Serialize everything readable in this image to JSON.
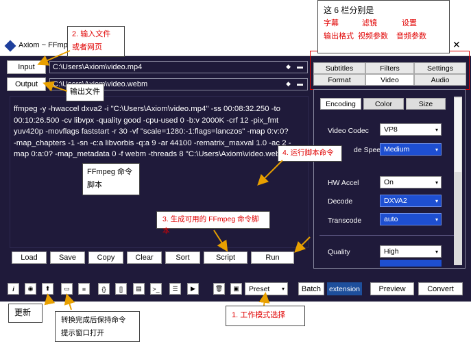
{
  "window": {
    "title": "Axiom ~ FFmpeg"
  },
  "main": {
    "input_label": "Input",
    "input_value": "C:\\Users\\Axiom\\video.mp4",
    "output_label": "Output",
    "output_value": "C:\\Users\\Axiom\\video.webm",
    "script_lines": [
      "ffmpeg -y -hwaccel dxva2 -i \"C:\\Users\\Axiom\\video.mp4\" -ss 00:08:32.250 -to",
      "00:10:26.500 -cv libvpx -quality good -cpu-used 0 -b:v 2000K -crf 12 -pix_fmt",
      "yuv420p -movflags faststart -r 30 -vf \"scale=1280:-1:flags=lanczos\" -map 0:v:0?",
      "-map_chapters -1 -sn -c:a libvorbis -q:a 9 -ar 44100 -rematrix_maxval 1.0 -ac 2 -",
      "map 0:a:0? -map_metadata 0 -f webm -threads 8 \"C:\\Users\\Axiom\\video.webm\""
    ],
    "buttons": [
      "Load",
      "Save",
      "Copy",
      "Clear",
      "Sort",
      "Script",
      "Run"
    ]
  },
  "right": {
    "tabs_row1": [
      "Subtitles",
      "Filters",
      "Settings"
    ],
    "tabs_row2": [
      "Format",
      "Video",
      "Audio"
    ],
    "subtabs": [
      "Encoding",
      "Color",
      "Size"
    ],
    "video_codec_label": "Video Codec",
    "video_codec": "VP8",
    "encode_speed_label": "de Speed",
    "encode_speed": "Medium",
    "hw_accel_label": "HW Accel",
    "hw_accel": "On",
    "decode_label": "Decode",
    "decode": "DXVA2",
    "transcode_label": "Transcode",
    "transcode": "auto",
    "quality_label": "Quality",
    "quality": "High"
  },
  "bottom": {
    "preset": "Preset",
    "batch": "Batch",
    "extension": "extension",
    "preview": "Preview",
    "convert": "Convert"
  },
  "notes": {
    "n1": "1. 工作模式选择",
    "n2a": "2. 输入文件",
    "n2b": "或者网页",
    "n3": "3. 生成可用的 FFmpeg 命令脚本",
    "n4": "4. 运行脚本命令",
    "out_file": "输出文件",
    "ffcmd_a": "FFmpeg 命令",
    "ffcmd_b": "脚本",
    "update": "更新",
    "keep_a": "转换完成后保持命令",
    "keep_b": "提示窗口打开",
    "cols_title": "这 6 栏分别是",
    "cols": [
      "字幕",
      "滤镜",
      "设置",
      "输出格式",
      "视频参数",
      "音频参数"
    ]
  }
}
